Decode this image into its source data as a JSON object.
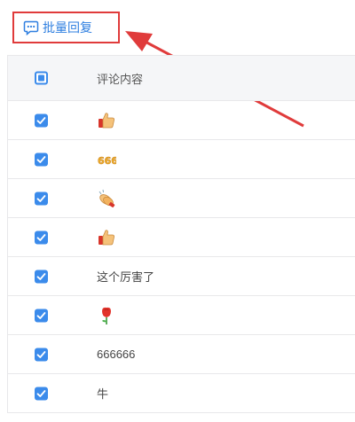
{
  "toolbar": {
    "batch_reply_label": "批量回复"
  },
  "table": {
    "header_label": "评论内容",
    "rows": [
      {
        "type": "emoji",
        "icon": "thumbs-up-emoji"
      },
      {
        "type": "emoji",
        "icon": "666-emoji"
      },
      {
        "type": "emoji",
        "icon": "clapping-hands-emoji"
      },
      {
        "type": "emoji",
        "icon": "thumbs-up-emoji"
      },
      {
        "type": "text",
        "text": "这个厉害了"
      },
      {
        "type": "emoji",
        "icon": "rose-emoji"
      },
      {
        "type": "text",
        "text": "666666"
      },
      {
        "type": "text",
        "text": "牛"
      }
    ]
  },
  "colors": {
    "accent": "#3b8beb",
    "highlight": "#e03b3b",
    "link": "#2f7fe0"
  }
}
